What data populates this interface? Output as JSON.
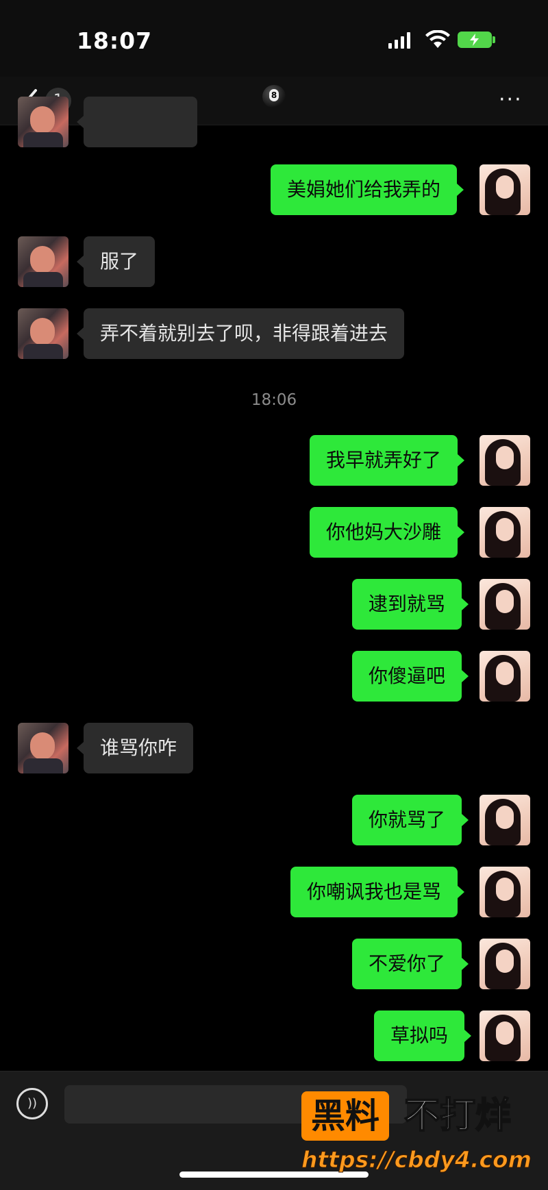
{
  "status_bar": {
    "time": "18:07"
  },
  "nav": {
    "unread_count": "1",
    "more_label": "···"
  },
  "messages": [
    {
      "side": "in",
      "text": ""
    },
    {
      "side": "out",
      "text": "美娟她们给我弄的"
    },
    {
      "side": "in",
      "text": "服了"
    },
    {
      "side": "in",
      "text": "弄不着就别去了呗，非得跟着进去"
    },
    {
      "side": "out",
      "text": "我早就弄好了"
    },
    {
      "side": "out",
      "text": "你他妈大沙雕"
    },
    {
      "side": "out",
      "text": "逮到就骂"
    },
    {
      "side": "out",
      "text": "你傻逼吧"
    },
    {
      "side": "in",
      "text": "谁骂你咋"
    },
    {
      "side": "out",
      "text": "你就骂了"
    },
    {
      "side": "out",
      "text": "你嘲讽我也是骂"
    },
    {
      "side": "out",
      "text": "不爱你了"
    },
    {
      "side": "out",
      "text": "草拟吗"
    }
  ],
  "timestamp": "18:06",
  "watermark": {
    "brand_box": "黑料",
    "brand_text": "不打烊",
    "url": "https://cbdy4.com"
  },
  "colors": {
    "bubble_out": "#2ee83a",
    "bubble_in": "#2c2c2c",
    "background": "#000000"
  }
}
